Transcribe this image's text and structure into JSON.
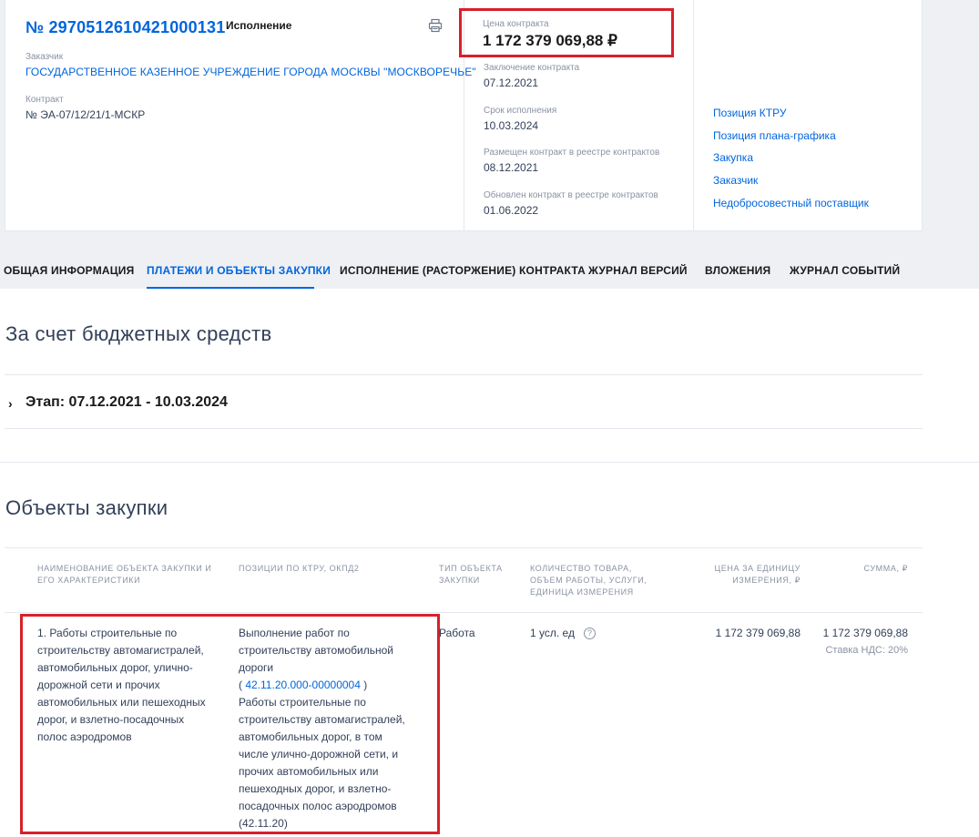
{
  "contract": {
    "reg_number": "№ 2970512610421000131",
    "status": "Исполнение",
    "customer_label": "Заказчик",
    "customer_name": "ГОСУДАРСТВЕННОЕ КАЗЕННОЕ УЧРЕЖДЕНИЕ ГОРОДА МОСКВЫ \"МОСКВОРЕЧЬЕ\"",
    "contract_label": "Контракт",
    "contract_number": "№ ЭА-07/12/21/1-МСКР"
  },
  "price": {
    "label": "Цена контракта",
    "value": "1 172 379 069,88 ₽"
  },
  "dates": [
    {
      "label": "Заключение контракта",
      "value": "07.12.2021"
    },
    {
      "label": "Срок исполнения",
      "value": "10.03.2024"
    },
    {
      "label": "Размещен контракт в реестре контрактов",
      "value": "08.12.2021"
    },
    {
      "label": "Обновлен контракт в реестре контрактов",
      "value": "01.06.2022"
    }
  ],
  "side_links": [
    "Позиция КТРУ",
    "Позиция плана-графика",
    "Закупка",
    "Заказчик",
    "Недобросовестный поставщик"
  ],
  "tabs": [
    {
      "label": "ОБЩАЯ ИНФОРМАЦИЯ",
      "active": false
    },
    {
      "label": "ПЛАТЕЖИ И ОБЪЕКТЫ ЗАКУПКИ",
      "active": true
    },
    {
      "label": "ИСПОЛНЕНИЕ (РАСТОРЖЕНИЕ) КОНТРАКТА",
      "active": false
    },
    {
      "label": "ЖУРНАЛ ВЕРСИЙ",
      "active": false
    },
    {
      "label": "ВЛОЖЕНИЯ",
      "active": false
    },
    {
      "label": "ЖУРНАЛ СОБЫТИЙ",
      "active": false
    }
  ],
  "budget_section": {
    "title": "За счет бюджетных средств",
    "stage": "Этап: 07.12.2021 - 10.03.2024"
  },
  "objects_section": {
    "title": "Объекты закупки",
    "headers": {
      "name": [
        "НАИМЕНОВАНИЕ ОБЪЕКТА ЗАКУПКИ И",
        "ЕГО ХАРАКТЕРИСТИКИ"
      ],
      "ktru": [
        "ПОЗИЦИИ ПО КТРУ, ОКПД2"
      ],
      "type": [
        "ТИП ОБЪЕКТА",
        "ЗАКУПКИ"
      ],
      "qty": [
        "КОЛИЧЕСТВО ТОВАРА,",
        "ОБЪЕМ РАБОТЫ, УСЛУГИ,",
        "ЕДИНИЦА ИЗМЕРЕНИЯ"
      ],
      "unit_price": [
        "ЦЕНА ЗА ЕДИНИЦУ",
        "ИЗМЕРЕНИЯ, ₽"
      ],
      "sum": [
        "СУММА, ₽"
      ]
    },
    "row": {
      "name_lines": [
        "1. Работы строительные по",
        "строительству автомагистралей,",
        "автомобильных дорог, улично-",
        "дорожной сети и прочих",
        "автомобильных или пешеходных",
        "дорог, и взлетно-посадочных",
        "полос аэродромов"
      ],
      "ktru_lines_1": [
        "Выполнение работ по",
        "строительству автомобильной",
        "дороги"
      ],
      "ktru_code_open": "( ",
      "ktru_code": "42.11.20.000-00000004",
      "ktru_code_close": " )",
      "ktru_lines_2": [
        "Работы строительные по",
        "строительству автомагистралей,",
        "автомобильных дорог, в том",
        "числе улично-дорожной сети, и",
        "прочих автомобильных или",
        "пешеходных дорог, и взлетно-",
        "посадочных полос аэродромов",
        "(42.11.20)"
      ],
      "type": "Работа",
      "qty": "1 усл. ед",
      "unit_price": "1 172 379 069,88",
      "sum": "1 172 379 069,88",
      "vat": "Ставка НДС: 20%"
    }
  }
}
